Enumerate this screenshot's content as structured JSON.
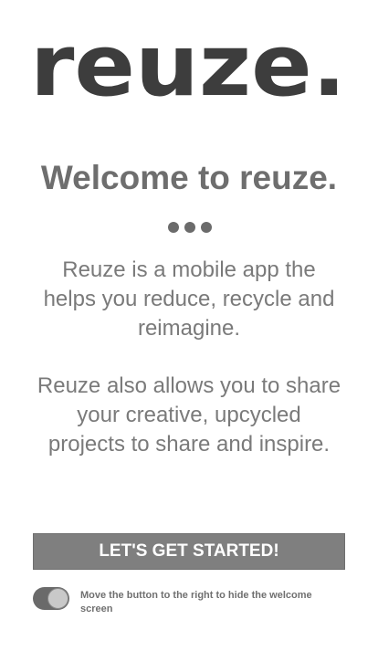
{
  "app": {
    "logo_text": "reuze."
  },
  "welcome": {
    "title": "Welcome to reuze.",
    "paragraph1": "Reuze is a mobile app the helps you reduce, recycle and reimagine.",
    "paragraph2": "Reuze also allows you to share your creative, upcycled projects to share and inspire."
  },
  "actions": {
    "cta_label": "LET'S GET STARTED!"
  },
  "toggle": {
    "label": "Move the button to the right to hide the welcome screen",
    "state": "on"
  },
  "icons": {
    "dots": "ellipsis-icon"
  },
  "colors": {
    "logo": "#3d3d3d",
    "title": "#6e6e6e",
    "body_text": "#7a7a7a",
    "button_bg": "#7f7f7f",
    "toggle_track": "#6a6a6a"
  }
}
